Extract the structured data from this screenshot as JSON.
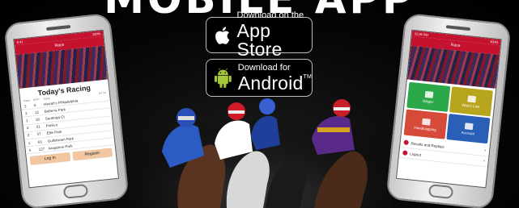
{
  "headline": "MOBILE APP",
  "app_store": {
    "small": "Download on the",
    "big": "App Store"
  },
  "android": {
    "small": "Download for",
    "big": "Android",
    "tm": "TM"
  },
  "left_phone": {
    "status_left": "9:41",
    "status_right": "100%",
    "appbar_title": "Race",
    "title": "Today's Racing",
    "col_race": "Race",
    "col_mtp": "MTP",
    "col_track": "Track",
    "col_date": "Jul 14",
    "rows": [
      {
        "race": "2",
        "mtp": "6",
        "track": "Harrah's Philadelphia"
      },
      {
        "race": "3",
        "mtp": "12",
        "track": "Belterra Park"
      },
      {
        "race": "1",
        "mtp": "18",
        "track": "Saratoga Ct"
      },
      {
        "race": "4",
        "mtp": "21",
        "track": "Pimlico"
      },
      {
        "race": "2",
        "mtp": "57",
        "track": "Ellis Park"
      },
      {
        "race": "1",
        "mtp": "63",
        "track": "Gulfstream Park"
      },
      {
        "race": "5",
        "mtp": "127",
        "track": "Arapahoe Park"
      }
    ],
    "login": "Log In",
    "register": "Register"
  },
  "right_phone": {
    "status_left": "12:06 PM",
    "status_right": "100%",
    "appbar_title": "Race",
    "tiles": {
      "wager": "Wager",
      "tv": "Watch Live",
      "hp": "Handicapping",
      "account": "Account"
    },
    "results_label": "Results and Replays",
    "logout_label": "Logout"
  },
  "colors": {
    "brand_red": "#c4122f",
    "tile_green": "#2aa84a",
    "tile_gold": "#b8a51e",
    "tile_orange": "#d64a3a",
    "tile_blue": "#2a5fb8"
  }
}
